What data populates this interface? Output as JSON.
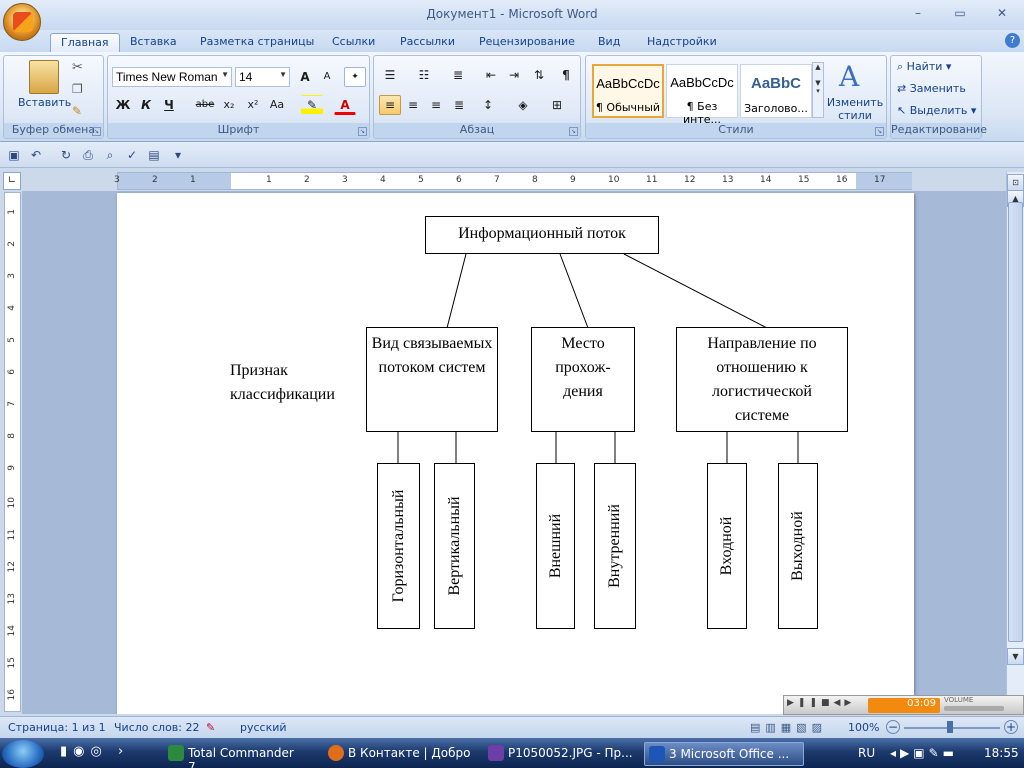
{
  "window": {
    "title": "Документ1 - Microsoft Word",
    "minimize_glyph": "–",
    "maximize_glyph": "▭",
    "close_glyph": "✕"
  },
  "tabs": [
    "Главная",
    "Вставка",
    "Разметка страницы",
    "Ссылки",
    "Рассылки",
    "Рецензирование",
    "Вид",
    "Надстройки"
  ],
  "help_glyph": "?",
  "ribbon": {
    "clipboard": {
      "label": "Буфер обмена",
      "paste": "Вставить"
    },
    "font": {
      "label": "Шрифт",
      "font_name": "Times New Roman",
      "font_size": "14",
      "grow": "A",
      "shrink": "A",
      "bold": "Ж",
      "italic": "К",
      "underline": "Ч",
      "strike": "abe",
      "sub": "x₂",
      "sup": "x²",
      "case": "Aa",
      "font_color": "A"
    },
    "paragraph": {
      "label": "Абзац"
    },
    "styles": {
      "label": "Стили",
      "items": [
        {
          "sample": "AaBbCcDc",
          "name": "¶ Обычный"
        },
        {
          "sample": "AaBbCcDc",
          "name": "¶ Без инте..."
        },
        {
          "sample": "AaBbC",
          "name": "Заголово..."
        }
      ],
      "change_styles": "Изменить стили"
    },
    "editing": {
      "label": "Редактирование",
      "find": "Найти",
      "replace": "Заменить",
      "select": "Выделить"
    }
  },
  "ruler": {
    "h_numbers": [
      "3",
      "2",
      "1",
      "1",
      "2",
      "3",
      "4",
      "5",
      "6",
      "7",
      "8",
      "9",
      "10",
      "11",
      "12",
      "13",
      "14",
      "15",
      "16",
      "17"
    ],
    "v_numbers": [
      "1",
      "2",
      "3",
      "4",
      "5",
      "6",
      "7",
      "8",
      "9",
      "10",
      "11",
      "12",
      "13",
      "14",
      "15",
      "16"
    ]
  },
  "diagram": {
    "root": "Информационный поток",
    "side_label": "Признак классификации",
    "categories": [
      {
        "text": "Вид связываемых потоком систем",
        "children": [
          "Горизонтальный",
          "Вертикальный"
        ]
      },
      {
        "text": "Место прохож-дения",
        "children": [
          "Внешний",
          "Внутренний"
        ]
      },
      {
        "text": "Направление по отношению к логистической системе",
        "children": [
          "Входной",
          "Выходной"
        ]
      }
    ]
  },
  "statusbar": {
    "page": "Страница: 1 из 1",
    "words": "Число слов: 22",
    "language": "русский",
    "zoom": "100%"
  },
  "media": {
    "time": "03:09",
    "volume_label": "VOLUME"
  },
  "taskbar": {
    "items": [
      {
        "label": "Total Commander 7....",
        "color": "#2b8a3e"
      },
      {
        "label": "В Контакте | Добро ...",
        "color": "#e06d1a"
      },
      {
        "label": "P1050052.JPG - Пр...",
        "color": "#6b3ea8"
      },
      {
        "label": "3 Microsoft Office ...",
        "color": "#1c57b8"
      }
    ],
    "lang": "RU",
    "clock": "18:55"
  }
}
